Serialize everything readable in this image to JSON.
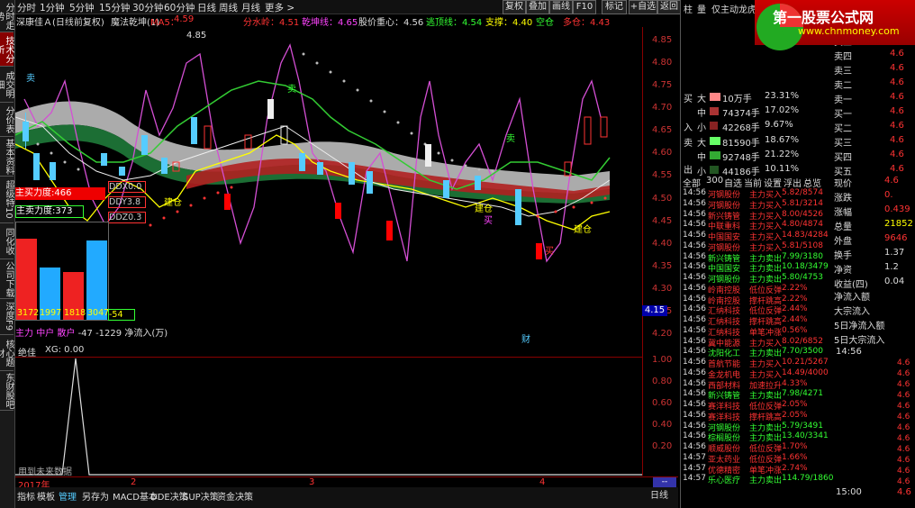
{
  "left_tabs": [
    "分时走势",
    "技术分析",
    "成交明细",
    "分价表",
    "基本资料",
    "超级特10",
    "同化收",
    "公司下载",
    "深度F9",
    "核心题材",
    "东财股吧"
  ],
  "periods": [
    "分时",
    "1分钟",
    "5分钟",
    "15分钟",
    "30分钟",
    "60分钟",
    "日线",
    "周线",
    "月线",
    "更多 >"
  ],
  "toolbar": [
    "复权",
    "叠加",
    "画线",
    "F10",
    "标记",
    "+自选",
    "返回"
  ],
  "info": {
    "stock": "深康佳Ａ(日线前复权)",
    "indicator": "魔法乾坤(1)",
    "ma5_label": "MA5：",
    "ma5": "4.59",
    "fen": "分水岭：4.51",
    "qk": "乾坤线：4.65",
    "gj": "股价重心：4.56",
    "xh": "逃顶线：4.54",
    "zc": "支撑：4.40",
    "kd": "空仓",
    "dc": "多仓：4.43"
  },
  "chart_labels": {
    "high": "4.85",
    "sell1": "卖",
    "sell2": "卖",
    "sell3": "卖",
    "jiancang1": "建仓",
    "jiancang2": "建仓",
    "jiancang3": "建仓",
    "buy1": "买",
    "buy2": "买",
    "cai": "财",
    "low": "4.15"
  },
  "overlay": {
    "zhu_mai_li": "主买力度:466",
    "zhu_mai_chu": "主卖力度:373",
    "ddx": "DDX0.0",
    "ddy": "DDY3.8",
    "ddz": "DDZ0.3",
    "bars": [
      "3172",
      "1997",
      "1818",
      "3047"
    ],
    "net": "-54",
    "legend_main": "主力",
    "legend_mid": "中户",
    "legend_small": "散户",
    "legend_values": "-47  -1229",
    "legend_tail": "净流入(万)"
  },
  "vol": {
    "title": "绝佳",
    "value": "XG: 0.00",
    "future": "用到未来数据"
  },
  "axis_main": [
    "4.85",
    "4.80",
    "4.75",
    "4.70",
    "4.65",
    "4.60",
    "4.55",
    "4.50",
    "4.45",
    "4.40",
    "4.35",
    "4.30",
    "4.25",
    "4.20"
  ],
  "axis_vol": [
    "1.00",
    "0.80",
    "0.60",
    "0.40",
    "0.20"
  ],
  "axis_highlight": "4.15",
  "dates": {
    "year": "2017年",
    "m2": "2",
    "m3": "3",
    "m4": "4"
  },
  "bottom_tabs": [
    "指标",
    "模板",
    "管理",
    "另存为",
    "MACD基本",
    "DDE决策",
    "SUP决策",
    "资金决策"
  ],
  "bottom_right": "日线",
  "rpanel": {
    "tabs": [
      "柱",
      "量",
      "仅主动",
      "龙虎"
    ],
    "banner_title": "第一股票公式网",
    "banner_url": "www.chnmoney.com",
    "asks": [
      {
        "label": "卖五",
        "price": "4.6"
      },
      {
        "label": "卖四",
        "price": "4.6"
      },
      {
        "label": "卖三",
        "price": "4.6"
      },
      {
        "label": "卖二",
        "price": "4.6"
      },
      {
        "label": "卖一",
        "price": "4.6"
      }
    ],
    "bids": [
      {
        "label": "买一",
        "price": "4.6"
      },
      {
        "label": "买二",
        "price": "4.6"
      },
      {
        "label": "买三",
        "price": "4.6"
      },
      {
        "label": "买四",
        "price": "4.6"
      },
      {
        "label": "买五",
        "price": "4.6"
      }
    ],
    "flow_in": [
      {
        "side": "大",
        "vol": "10万手",
        "pct": "23.31%"
      },
      {
        "side": "中",
        "vol": "74374手",
        "pct": "17.02%"
      },
      {
        "side": "小",
        "vol": "42268手",
        "pct": "9.67%"
      }
    ],
    "flow_out": [
      {
        "side": "大",
        "vol": "81590手",
        "pct": "18.67%"
      },
      {
        "side": "中",
        "vol": "92748手",
        "pct": "21.22%"
      },
      {
        "side": "小",
        "vol": "44186手",
        "pct": "10.11%"
      }
    ],
    "flow_in_label": [
      "买",
      "入"
    ],
    "flow_out_label": [
      "卖",
      "出"
    ],
    "list_tabs": [
      "全部",
      "300",
      "自选",
      "当前",
      "设置",
      "浮出",
      "总览"
    ],
    "ticks": [
      {
        "t": "14:56",
        "n": "河钢股份",
        "s": "主力买入",
        "v": "5.82/8574",
        "c": "red"
      },
      {
        "t": "14:56",
        "n": "河钢股份",
        "s": "主力买入",
        "v": "5.81/3214",
        "c": "red"
      },
      {
        "t": "14:56",
        "n": "新兴铸管",
        "s": "主力买入",
        "v": "8.00/4526",
        "c": "red"
      },
      {
        "t": "14:56",
        "n": "中联重科",
        "s": "主力买入",
        "v": "4.80/4874",
        "c": "red"
      },
      {
        "t": "14:56",
        "n": "中国国安",
        "s": "主力买入",
        "v": "14.83/4284",
        "c": "red"
      },
      {
        "t": "14:56",
        "n": "河钢股份",
        "s": "主力买入",
        "v": "5.81/5108",
        "c": "red"
      },
      {
        "t": "14:56",
        "n": "新兴铸管",
        "s": "主力卖出",
        "v": "7.99/3180",
        "c": "grn"
      },
      {
        "t": "14:56",
        "n": "中国国安",
        "s": "主力卖出",
        "v": "10.18/3479",
        "c": "grn"
      },
      {
        "t": "14:56",
        "n": "河钢股份",
        "s": "主力卖出",
        "v": "5.80/4753",
        "c": "grn"
      },
      {
        "t": "14:56",
        "n": "岭南控股",
        "s": "低位反弹",
        "v": "2.22%",
        "c": "red"
      },
      {
        "t": "14:56",
        "n": "岭南控股",
        "s": "撑杆跳高",
        "v": "2.22%",
        "c": "red"
      },
      {
        "t": "14:56",
        "n": "汇纳科技",
        "s": "低位反弹",
        "v": "2.44%",
        "c": "red"
      },
      {
        "t": "14:56",
        "n": "汇纳科技",
        "s": "撑杆跳高",
        "v": "2.44%",
        "c": "red"
      },
      {
        "t": "14:56",
        "n": "汇纳科技",
        "s": "单笔冲涨",
        "v": "0.56%",
        "c": "red"
      },
      {
        "t": "14:56",
        "n": "冀中能源",
        "s": "主力买入",
        "v": "8.02/6852",
        "c": "red"
      },
      {
        "t": "14:56",
        "n": "沈阳化工",
        "s": "主力卖出",
        "v": "7.70/3500",
        "c": "grn"
      },
      {
        "t": "14:56",
        "n": "首航节能",
        "s": "主力买入",
        "v": "10.21/5267",
        "c": "red"
      },
      {
        "t": "14:56",
        "n": "金龙机电",
        "s": "主力买入",
        "v": "14.49/4000",
        "c": "red"
      },
      {
        "t": "14:56",
        "n": "西部材料",
        "s": "加速拉升",
        "v": "4.33%",
        "c": "red"
      },
      {
        "t": "14:56",
        "n": "新兴铸管",
        "s": "主力卖出",
        "v": "7.98/4271",
        "c": "grn"
      },
      {
        "t": "14:56",
        "n": "赛洋科技",
        "s": "低位反弹",
        "v": "2.05%",
        "c": "red"
      },
      {
        "t": "14:56",
        "n": "赛洋科技",
        "s": "撑杆跳高",
        "v": "2.05%",
        "c": "red"
      },
      {
        "t": "14:56",
        "n": "河钢股份",
        "s": "主力卖出",
        "v": "5.79/3491",
        "c": "grn"
      },
      {
        "t": "14:56",
        "n": "棕榈股份",
        "s": "主力卖出",
        "v": "13.40/3341",
        "c": "grn"
      },
      {
        "t": "14:56",
        "n": "顺威股份",
        "s": "低位反弹",
        "v": "1.70%",
        "c": "red"
      },
      {
        "t": "14:57",
        "n": "亚太药业",
        "s": "低位反弹",
        "v": "1.66%",
        "c": "red"
      },
      {
        "t": "14:57",
        "n": "优德精密",
        "s": "单笔冲涨",
        "v": "2.74%",
        "c": "red"
      },
      {
        "t": "14:57",
        "n": "乐心医疗",
        "s": "主力卖出",
        "v": "114.79/1860",
        "c": "grn"
      }
    ],
    "quote": [
      {
        "k": "现价",
        "v": "4.6",
        "c": "red"
      },
      {
        "k": "涨跌",
        "v": "0.",
        "c": "red"
      },
      {
        "k": "涨幅",
        "v": "0.439",
        "c": "red"
      },
      {
        "k": "总量",
        "v": "21852",
        "c": "yel"
      },
      {
        "k": "外盘",
        "v": "9646",
        "c": "red"
      },
      {
        "k": "换手",
        "v": "1.37",
        "c": "wht"
      },
      {
        "k": "净资",
        "v": "1.2",
        "c": "wht"
      },
      {
        "k": "收益(四)",
        "v": "0.04",
        "c": "wht"
      }
    ],
    "capital": [
      "净流入额",
      "大宗流入",
      "5日净流入额",
      "5日大宗流入"
    ],
    "time1": "14:56",
    "right_prices": [
      "4.6",
      "4.6",
      "4.6",
      "4.6",
      "4.6",
      "4.6",
      "4.6",
      "4.6",
      "4.6",
      "4.6",
      "4.6",
      "4.6"
    ],
    "time2": "15:00",
    "time2_price": "4.6"
  },
  "chart_data": {
    "type": "candlestick",
    "ylim": [
      4.15,
      4.88
    ],
    "dates_shown": [
      "2017年",
      "2",
      "3",
      "4"
    ],
    "ma5_last": 4.59,
    "annotations": [
      "卖",
      "建仓",
      "买",
      "财"
    ]
  }
}
